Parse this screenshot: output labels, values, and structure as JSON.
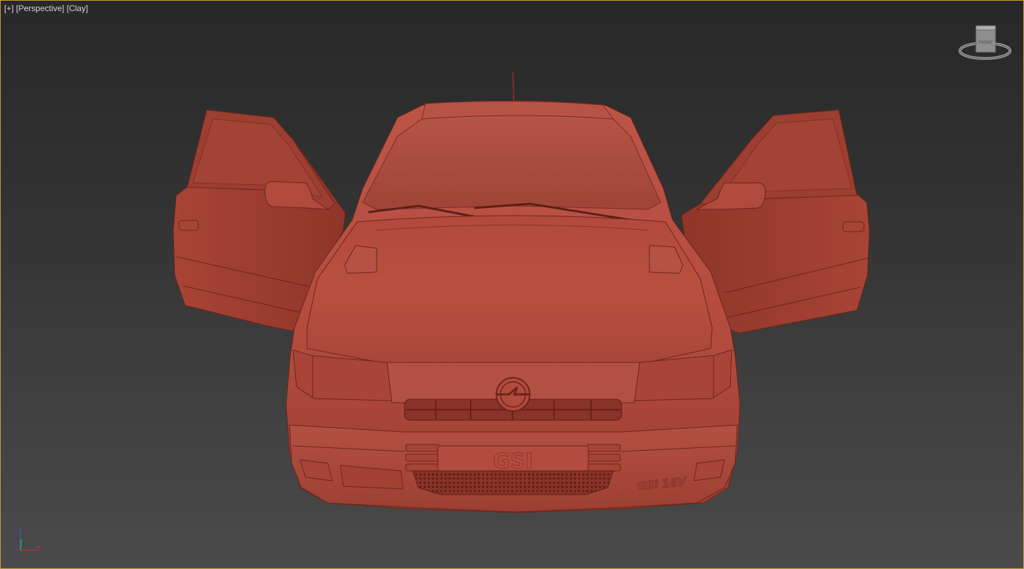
{
  "viewport": {
    "label_plus": "[+]",
    "label_view": "[Perspective]",
    "label_shading": "[Clay]"
  },
  "viewcube": {
    "face_label": "FRONT"
  },
  "axis": {
    "z_label": "z",
    "y_label": "y",
    "x_label": "x"
  },
  "colors": {
    "viewport_border": "#c8a23a",
    "clay_base": "#b04a3e",
    "clay_light": "#c2584a",
    "clay_dark": "#7a2c22",
    "axis_x": "#d03020",
    "axis_y": "#30c040",
    "axis_z": "#4060e0"
  },
  "icons": {
    "viewcube": "viewcube-icon",
    "axis": "axis-tripod-icon"
  }
}
